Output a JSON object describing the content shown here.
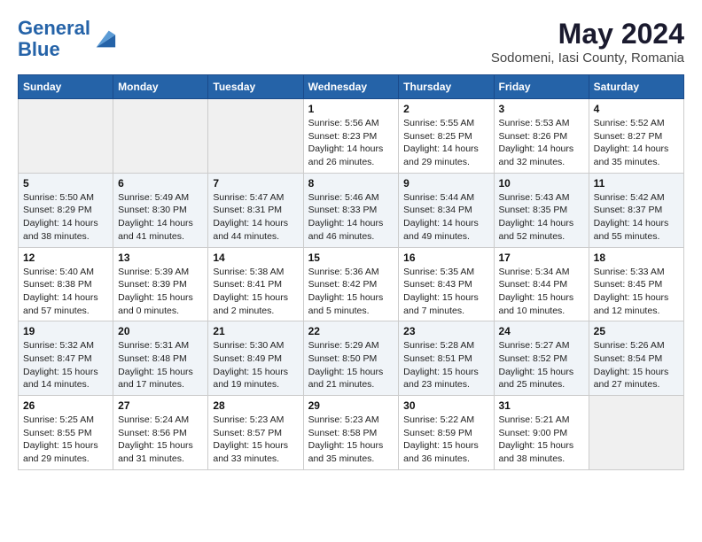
{
  "logo": {
    "line1": "General",
    "line2": "Blue"
  },
  "title": "May 2024",
  "subtitle": "Sodomeni, Iasi County, Romania",
  "days_header": [
    "Sunday",
    "Monday",
    "Tuesday",
    "Wednesday",
    "Thursday",
    "Friday",
    "Saturday"
  ],
  "weeks": [
    [
      {
        "num": "",
        "info": ""
      },
      {
        "num": "",
        "info": ""
      },
      {
        "num": "",
        "info": ""
      },
      {
        "num": "1",
        "info": "Sunrise: 5:56 AM\nSunset: 8:23 PM\nDaylight: 14 hours\nand 26 minutes."
      },
      {
        "num": "2",
        "info": "Sunrise: 5:55 AM\nSunset: 8:25 PM\nDaylight: 14 hours\nand 29 minutes."
      },
      {
        "num": "3",
        "info": "Sunrise: 5:53 AM\nSunset: 8:26 PM\nDaylight: 14 hours\nand 32 minutes."
      },
      {
        "num": "4",
        "info": "Sunrise: 5:52 AM\nSunset: 8:27 PM\nDaylight: 14 hours\nand 35 minutes."
      }
    ],
    [
      {
        "num": "5",
        "info": "Sunrise: 5:50 AM\nSunset: 8:29 PM\nDaylight: 14 hours\nand 38 minutes."
      },
      {
        "num": "6",
        "info": "Sunrise: 5:49 AM\nSunset: 8:30 PM\nDaylight: 14 hours\nand 41 minutes."
      },
      {
        "num": "7",
        "info": "Sunrise: 5:47 AM\nSunset: 8:31 PM\nDaylight: 14 hours\nand 44 minutes."
      },
      {
        "num": "8",
        "info": "Sunrise: 5:46 AM\nSunset: 8:33 PM\nDaylight: 14 hours\nand 46 minutes."
      },
      {
        "num": "9",
        "info": "Sunrise: 5:44 AM\nSunset: 8:34 PM\nDaylight: 14 hours\nand 49 minutes."
      },
      {
        "num": "10",
        "info": "Sunrise: 5:43 AM\nSunset: 8:35 PM\nDaylight: 14 hours\nand 52 minutes."
      },
      {
        "num": "11",
        "info": "Sunrise: 5:42 AM\nSunset: 8:37 PM\nDaylight: 14 hours\nand 55 minutes."
      }
    ],
    [
      {
        "num": "12",
        "info": "Sunrise: 5:40 AM\nSunset: 8:38 PM\nDaylight: 14 hours\nand 57 minutes."
      },
      {
        "num": "13",
        "info": "Sunrise: 5:39 AM\nSunset: 8:39 PM\nDaylight: 15 hours\nand 0 minutes."
      },
      {
        "num": "14",
        "info": "Sunrise: 5:38 AM\nSunset: 8:41 PM\nDaylight: 15 hours\nand 2 minutes."
      },
      {
        "num": "15",
        "info": "Sunrise: 5:36 AM\nSunset: 8:42 PM\nDaylight: 15 hours\nand 5 minutes."
      },
      {
        "num": "16",
        "info": "Sunrise: 5:35 AM\nSunset: 8:43 PM\nDaylight: 15 hours\nand 7 minutes."
      },
      {
        "num": "17",
        "info": "Sunrise: 5:34 AM\nSunset: 8:44 PM\nDaylight: 15 hours\nand 10 minutes."
      },
      {
        "num": "18",
        "info": "Sunrise: 5:33 AM\nSunset: 8:45 PM\nDaylight: 15 hours\nand 12 minutes."
      }
    ],
    [
      {
        "num": "19",
        "info": "Sunrise: 5:32 AM\nSunset: 8:47 PM\nDaylight: 15 hours\nand 14 minutes."
      },
      {
        "num": "20",
        "info": "Sunrise: 5:31 AM\nSunset: 8:48 PM\nDaylight: 15 hours\nand 17 minutes."
      },
      {
        "num": "21",
        "info": "Sunrise: 5:30 AM\nSunset: 8:49 PM\nDaylight: 15 hours\nand 19 minutes."
      },
      {
        "num": "22",
        "info": "Sunrise: 5:29 AM\nSunset: 8:50 PM\nDaylight: 15 hours\nand 21 minutes."
      },
      {
        "num": "23",
        "info": "Sunrise: 5:28 AM\nSunset: 8:51 PM\nDaylight: 15 hours\nand 23 minutes."
      },
      {
        "num": "24",
        "info": "Sunrise: 5:27 AM\nSunset: 8:52 PM\nDaylight: 15 hours\nand 25 minutes."
      },
      {
        "num": "25",
        "info": "Sunrise: 5:26 AM\nSunset: 8:54 PM\nDaylight: 15 hours\nand 27 minutes."
      }
    ],
    [
      {
        "num": "26",
        "info": "Sunrise: 5:25 AM\nSunset: 8:55 PM\nDaylight: 15 hours\nand 29 minutes."
      },
      {
        "num": "27",
        "info": "Sunrise: 5:24 AM\nSunset: 8:56 PM\nDaylight: 15 hours\nand 31 minutes."
      },
      {
        "num": "28",
        "info": "Sunrise: 5:23 AM\nSunset: 8:57 PM\nDaylight: 15 hours\nand 33 minutes."
      },
      {
        "num": "29",
        "info": "Sunrise: 5:23 AM\nSunset: 8:58 PM\nDaylight: 15 hours\nand 35 minutes."
      },
      {
        "num": "30",
        "info": "Sunrise: 5:22 AM\nSunset: 8:59 PM\nDaylight: 15 hours\nand 36 minutes."
      },
      {
        "num": "31",
        "info": "Sunrise: 5:21 AM\nSunset: 9:00 PM\nDaylight: 15 hours\nand 38 minutes."
      },
      {
        "num": "",
        "info": ""
      }
    ]
  ]
}
